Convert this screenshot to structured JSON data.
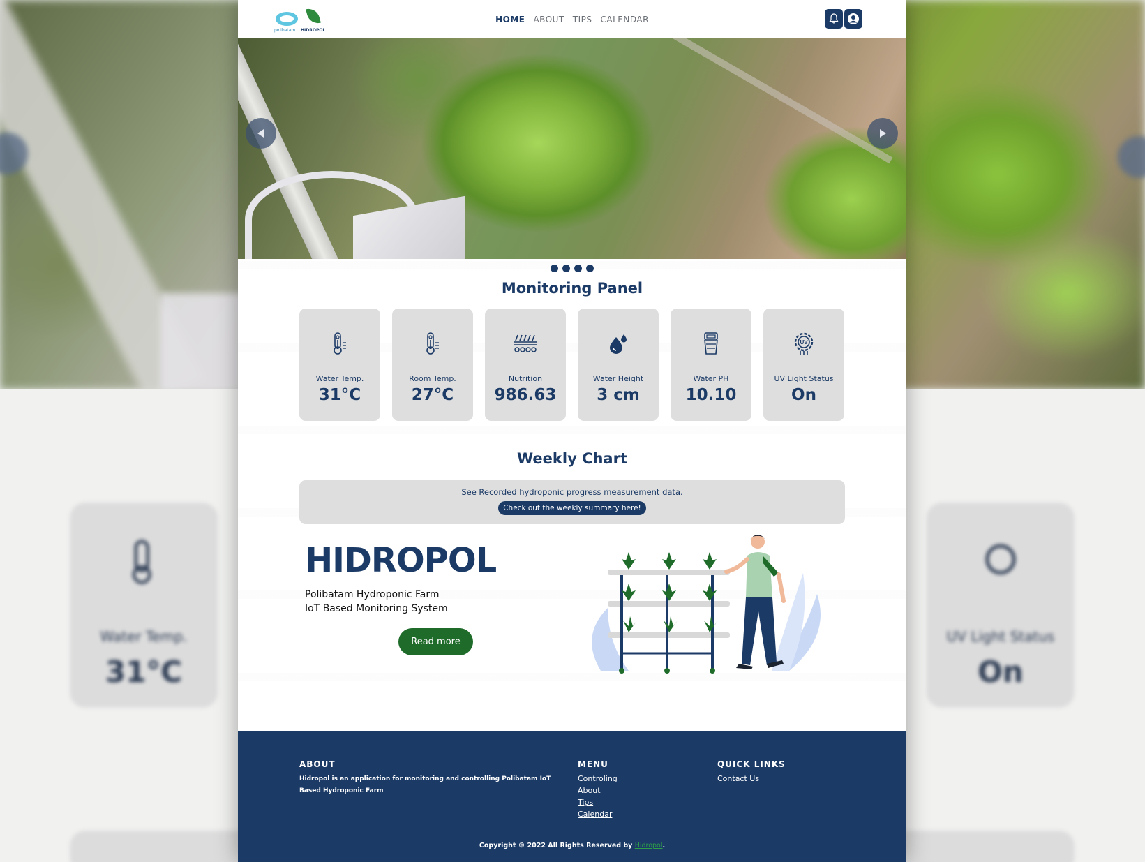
{
  "nav": {
    "logo_left": "polibatam",
    "logo_right": "HIDROPOL",
    "links": [
      "HOME",
      "ABOUT",
      "TIPS",
      "CALENDAR"
    ],
    "active": "HOME",
    "icons": [
      "bell-icon",
      "user-icon"
    ]
  },
  "hero": {
    "slide_count": 4,
    "prev_icon": "chevron-left-icon",
    "next_icon": "chevron-right-icon"
  },
  "monitoring": {
    "title": "Monitoring Panel",
    "cards": [
      {
        "label": "Water Temp.",
        "value": "31°C",
        "icon": "thermometer-icon"
      },
      {
        "label": "Room Temp.",
        "value": "27°C",
        "icon": "thermometer-icon"
      },
      {
        "label": "Nutrition",
        "value": "986.63",
        "icon": "nutrition-icon"
      },
      {
        "label": "Water Height",
        "value": "3 cm",
        "icon": "water-drop-icon"
      },
      {
        "label": "Water PH",
        "value": "10.10",
        "icon": "ph-meter-icon"
      },
      {
        "label": "UV Light Status",
        "value": "On",
        "icon": "uv-icon"
      }
    ]
  },
  "weekly": {
    "title": "Weekly Chart",
    "text": "See Recorded hydroponic progress measurement data.",
    "button": "Check out the weekly summary here!"
  },
  "about_hero": {
    "brand": "HIDROPOL",
    "line1": "Polibatam Hydroponic Farm",
    "line2": "IoT Based Monitoring System",
    "button": "Read more"
  },
  "footer": {
    "about_title": "ABOUT",
    "about_text": "Hidropol is an application for monitoring and controlling Polibatam IoT Based Hydroponic Farm",
    "menu_title": "MENU",
    "menu": [
      "Controling",
      "About",
      "Tips",
      "Calendar"
    ],
    "links_title": "QUICK LINKS",
    "links": [
      "Contact Us"
    ],
    "copyright_prefix": "Copyright © 2022 All Rights Reserved by ",
    "copyright_brand": "Hidropol",
    "copyright_suffix": "."
  },
  "colors": {
    "primary": "#1b3a66",
    "accent_green": "#1e6b2a",
    "card_bg": "#dedede"
  }
}
